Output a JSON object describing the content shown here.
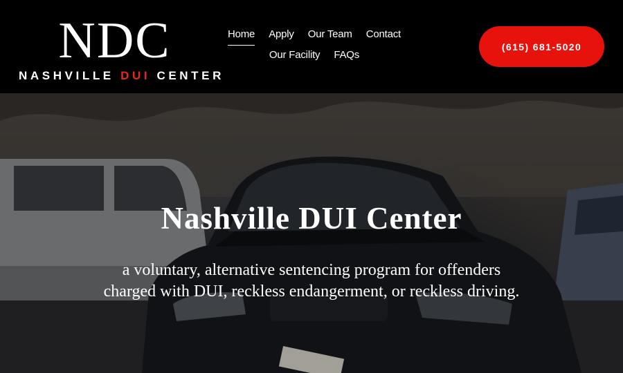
{
  "header": {
    "logo": {
      "mark": "NDC",
      "sub_before": "NASHVILLE ",
      "sub_highlight": "DUI",
      "sub_after": " CENTER"
    },
    "nav": [
      {
        "label": "Home",
        "active": true
      },
      {
        "label": "Apply"
      },
      {
        "label": "Our Team"
      },
      {
        "label": "Contact"
      },
      {
        "label": "Our Facility"
      },
      {
        "label": "FAQs"
      }
    ],
    "phone_label": "(615) 681-5020"
  },
  "hero": {
    "title": "Nashville DUI Center",
    "subtitle": "a voluntary, alternative sentencing program for offenders charged with DUI, reckless endangerment, or reckless driving."
  },
  "colors": {
    "header_bg": "#000000",
    "accent": "#e8120c",
    "logo_red": "#e8261f",
    "text": "#ffffff"
  }
}
